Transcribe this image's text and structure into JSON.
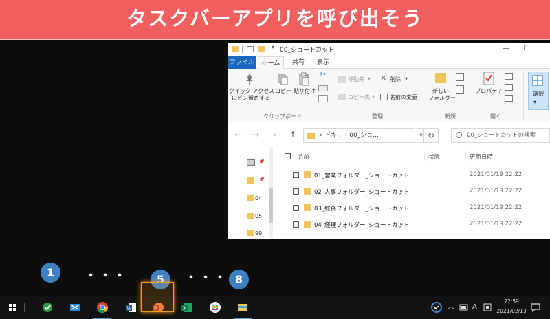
{
  "banner": {
    "title": "タスクバーアプリを呼び出そう"
  },
  "explorer": {
    "window_title": "00_ショートカット",
    "tabs": [
      "ファイル",
      "ホーム",
      "共有",
      "表示"
    ],
    "ribbon": {
      "pin_label": "クイック アクセス\nにピン留めする",
      "copy_label": "コピー",
      "paste_label": "貼り付け",
      "clipboard_group": "クリップボード",
      "move_to": "移動先",
      "copy_to": "コピー先",
      "delete": "削除",
      "rename": "名前の変更",
      "organize_group": "整理",
      "new_folder": "新しい\nフォルダー",
      "new_group": "新規",
      "properties": "プロパティ",
      "open_group": "開く",
      "select": "選択"
    },
    "address": {
      "path": "« ドキ... › 00_ショ...",
      "search_placeholder": "00_ショートカットの検索"
    },
    "nav_items": [
      "04_",
      "05_",
      "99_"
    ],
    "columns": {
      "name": "名前",
      "status": "状態",
      "date": "更新日時"
    },
    "files": [
      {
        "name": "01_営業フォルダー_ショートカット",
        "date": "2021/01/19 22:22"
      },
      {
        "name": "02_人事フォルダー_ショートカット",
        "date": "2021/01/19 22:22"
      },
      {
        "name": "03_総務フォルダー_ショートカット",
        "date": "2021/01/19 22:22"
      },
      {
        "name": "04_経理フォルダー_ショートカット",
        "date": "2021/01/19 22:22"
      }
    ]
  },
  "markers": {
    "first": "1",
    "fifth": "5",
    "eighth": "8",
    "ellipsis": "・・・"
  },
  "taskbar": {
    "apps": [
      "windows-start",
      "green-check-app",
      "rdp-app",
      "chrome",
      "word",
      "powerpoint",
      "excel",
      "slack",
      "file-explorer"
    ],
    "highlighted_app": "powerpoint",
    "ime_label": "A",
    "time": "22:59",
    "date": "2021/02/13"
  },
  "colors": {
    "banner": "#f25f5f",
    "marker": "#3e80c4",
    "highlight": "#f59a22",
    "file_tab": "#1b6ac1"
  }
}
